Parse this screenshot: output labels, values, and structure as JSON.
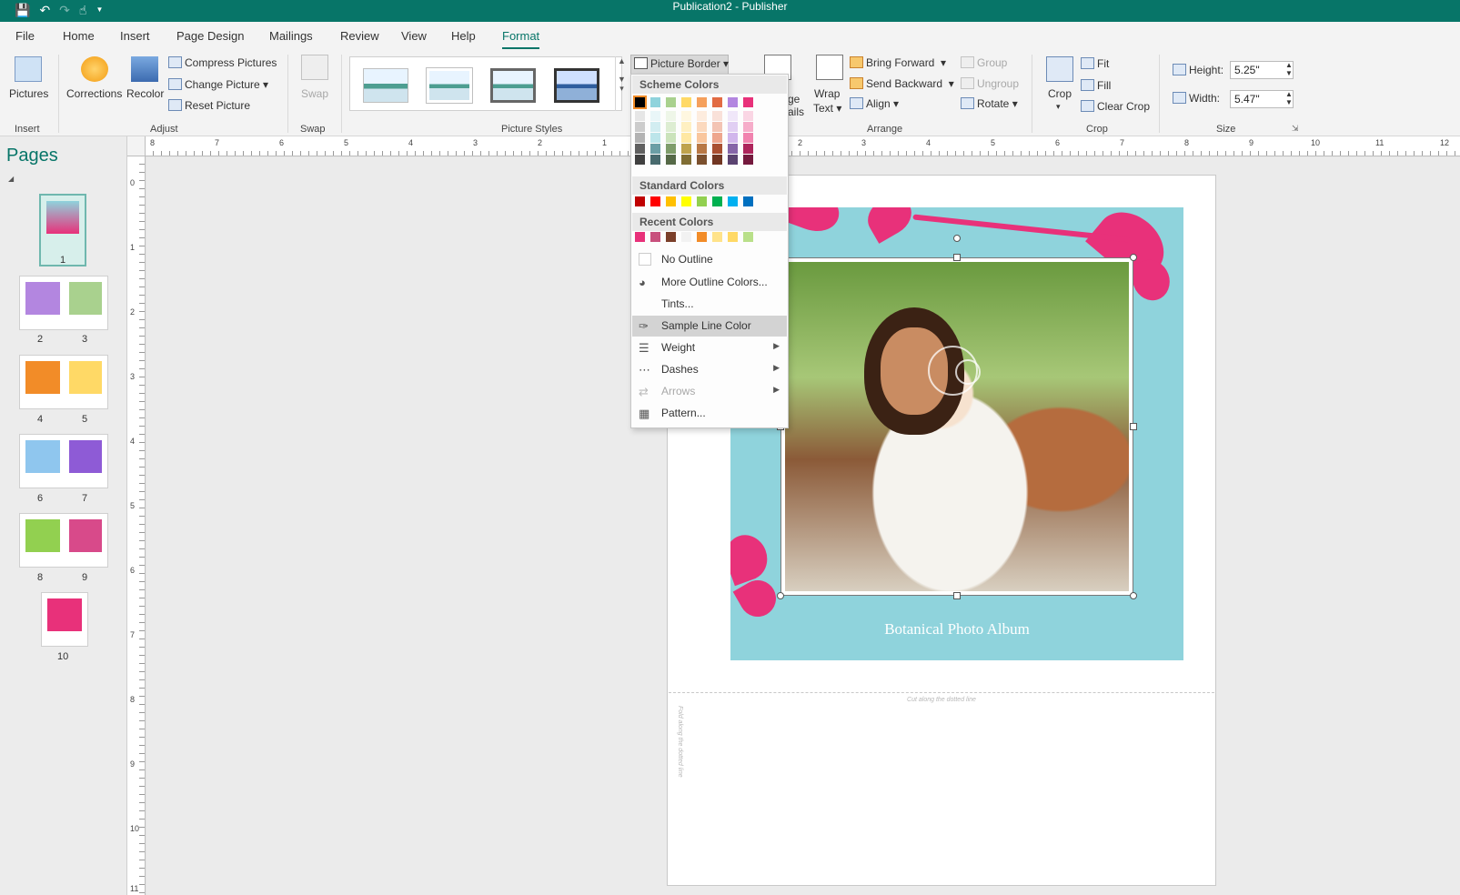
{
  "titlebar": {
    "title": "Publication2  -  Publisher"
  },
  "menu": {
    "file": "File",
    "home": "Home",
    "insert": "Insert",
    "page_design": "Page Design",
    "mailings": "Mailings",
    "review": "Review",
    "view": "View",
    "help": "Help",
    "format": "Format"
  },
  "ribbon": {
    "insert_group": {
      "pictures": "Pictures",
      "label": "Insert"
    },
    "adjust_group": {
      "corrections": "Corrections",
      "recolor": "Recolor",
      "compress": "Compress Pictures",
      "change": "Change Picture",
      "reset": "Reset Picture",
      "label": "Adjust"
    },
    "swap_group": {
      "swap": "Swap",
      "label": "Swap"
    },
    "picture_styles": {
      "label": "Picture Styles",
      "border_button": "Picture Border"
    },
    "arrange_group": {
      "captions": "ge",
      "captions2": "ails",
      "wrap": "Wrap",
      "wrap2": "Text",
      "bring_forward": "Bring Forward",
      "send_backward": "Send Backward",
      "align": "Align",
      "group": "Group",
      "ungroup": "Ungroup",
      "rotate": "Rotate",
      "label": "Arrange"
    },
    "crop_group": {
      "crop": "Crop",
      "fit": "Fit",
      "fill": "Fill",
      "clear_crop": "Clear Crop",
      "label": "Crop"
    },
    "size_group": {
      "height_label": "Height:",
      "height_value": "5.25\"",
      "width_label": "Width:",
      "width_value": "5.47\"",
      "label": "Size"
    }
  },
  "pages_pane": {
    "title": "Pages",
    "pages": [
      "1",
      "2",
      "3",
      "4",
      "5",
      "6",
      "7",
      "8",
      "9",
      "10"
    ]
  },
  "ruler": {
    "h": [
      "8",
      "7",
      "6",
      "5",
      "4",
      "3",
      "2",
      "1",
      "2",
      "3",
      "4",
      "5",
      "6",
      "7",
      "8",
      "9",
      "10",
      "11",
      "12"
    ],
    "v": [
      "0",
      "1",
      "2",
      "3",
      "4",
      "5",
      "6",
      "7",
      "8",
      "9",
      "10",
      "11"
    ]
  },
  "publication": {
    "card_title": "Botanical Photo Album",
    "cut_text": "Cut along the dotted line",
    "side_text": "Fold along the dotted line"
  },
  "dropdown": {
    "scheme_colors": "Scheme Colors",
    "standard_colors": "Standard Colors",
    "recent_colors": "Recent Colors",
    "no_outline": "No Outline",
    "more_colors": "More Outline Colors...",
    "tints": "Tints...",
    "sample": "Sample Line Color",
    "weight": "Weight",
    "dashes": "Dashes",
    "arrows": "Arrows",
    "pattern": "Pattern...",
    "scheme_row": [
      "#000000",
      "#8fd3dc",
      "#a9d18e",
      "#ffd966",
      "#f5a05c",
      "#e26b43",
      "#b386e0",
      "#e8317a"
    ],
    "standard_row": [
      "#c00000",
      "#ff0000",
      "#ffc000",
      "#ffff00",
      "#92d050",
      "#00b050",
      "#00b0f0",
      "#0070c0"
    ],
    "recent_row": [
      "#e8317a",
      "#c8507d",
      "#7b3f2a",
      "#f2f2f2",
      "#f28c28",
      "#ffe38a",
      "#ffd966",
      "#b9e08a"
    ]
  }
}
